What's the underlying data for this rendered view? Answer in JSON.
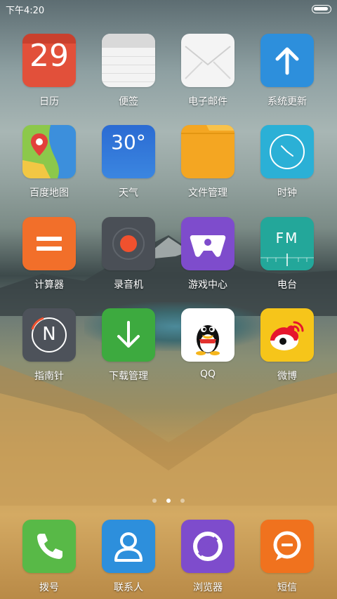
{
  "status_bar": {
    "time": "下午4:20"
  },
  "apps": [
    {
      "label": "日历",
      "icon": "calendar-icon",
      "day": "29"
    },
    {
      "label": "便签",
      "icon": "notes-icon"
    },
    {
      "label": "电子邮件",
      "icon": "mail-icon"
    },
    {
      "label": "系统更新",
      "icon": "update-icon"
    },
    {
      "label": "百度地图",
      "icon": "map-icon"
    },
    {
      "label": "天气",
      "icon": "weather-icon",
      "temp": "30°"
    },
    {
      "label": "文件管理",
      "icon": "folder-icon"
    },
    {
      "label": "时钟",
      "icon": "clock-icon"
    },
    {
      "label": "计算器",
      "icon": "calculator-icon"
    },
    {
      "label": "录音机",
      "icon": "recorder-icon"
    },
    {
      "label": "游戏中心",
      "icon": "gamepad-icon"
    },
    {
      "label": "电台",
      "icon": "radio-icon",
      "text": "FM"
    },
    {
      "label": "指南针",
      "icon": "compass-icon",
      "text": "N"
    },
    {
      "label": "下载管理",
      "icon": "download-icon"
    },
    {
      "label": "QQ",
      "icon": "qq-icon"
    },
    {
      "label": "微博",
      "icon": "weibo-icon"
    }
  ],
  "dock": [
    {
      "label": "拨号",
      "icon": "phone-icon"
    },
    {
      "label": "联系人",
      "icon": "contacts-icon"
    },
    {
      "label": "浏览器",
      "icon": "browser-icon"
    },
    {
      "label": "短信",
      "icon": "message-icon"
    }
  ],
  "colors": {
    "calendar": "#e2503a",
    "update": "#2d8fdc",
    "weather": "#2e72d6",
    "folder": "#f4a622",
    "clock": "#2bb0d6",
    "calculator": "#f26f2a",
    "recorder": "#4a4f56",
    "game": "#7e4ccc",
    "radio": "#23a79a",
    "compass": "#4d525a",
    "download": "#3daa3f",
    "weibo": "#f6c51a",
    "phone": "#58b947",
    "contacts": "#2d8fdc",
    "browser": "#7e4ccc",
    "message": "#f0721e"
  },
  "page_indicator": {
    "count": 3,
    "active": 1
  }
}
